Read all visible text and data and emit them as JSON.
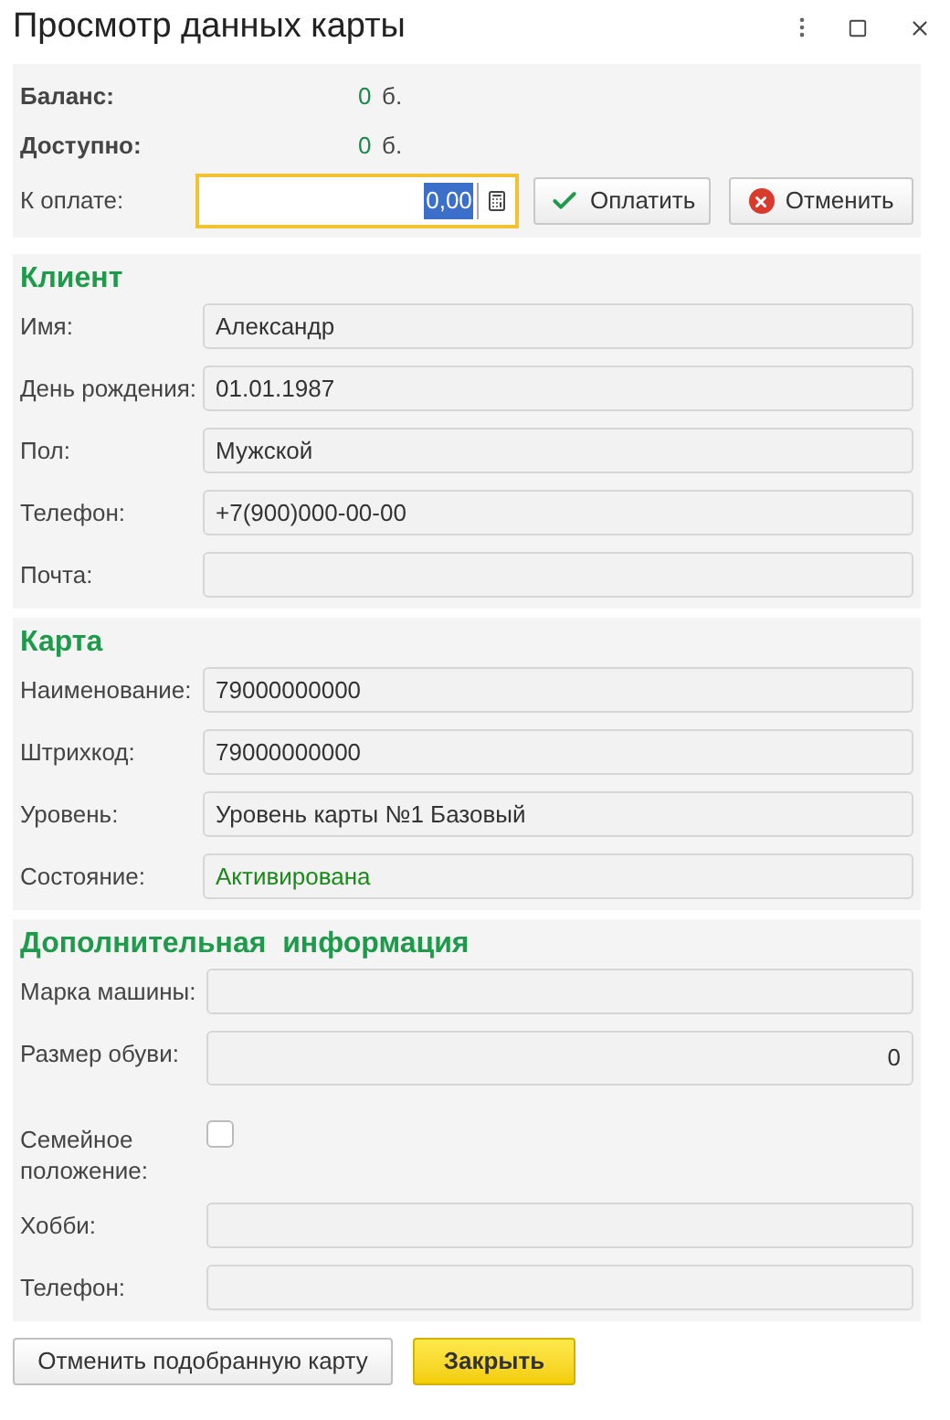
{
  "window": {
    "title": "Просмотр данных карты"
  },
  "summary": [
    {
      "label": "Баланс:",
      "value": "0",
      "unit": "б."
    },
    {
      "label": "Доступно:",
      "value": "0",
      "unit": "б."
    }
  ],
  "payment": {
    "label": "К оплате:",
    "value": "0,00",
    "focused": true,
    "buttons": [
      {
        "label": "Оплатить",
        "kind": "confirm"
      },
      {
        "label": "Отменить",
        "kind": "cancel"
      }
    ]
  },
  "sections": [
    {
      "title": "Клиент",
      "fields": [
        {
          "label": "Имя:",
          "value": "Александр",
          "kind": "text"
        },
        {
          "label": "День рождения:",
          "value": "01.01.1987",
          "kind": "text"
        },
        {
          "label": "Пол:",
          "value": "Мужской",
          "kind": "text"
        },
        {
          "label": "Телефон:",
          "value": "+7(900)000-00-00",
          "kind": "text"
        },
        {
          "label": "Почта:",
          "kind": "text"
        }
      ]
    },
    {
      "title": "Карта",
      "fields": [
        {
          "label": "Наименование:",
          "value": "79000000000",
          "kind": "text"
        },
        {
          "label": "Штрихкод:",
          "value": "79000000000",
          "kind": "text"
        },
        {
          "label": "Уровень:",
          "value": "Уровень карты №1 Базовый",
          "kind": "text"
        },
        {
          "label": "Состояние:",
          "value": "Активирована",
          "kind": "text",
          "color": "#1a8a1a"
        }
      ]
    },
    {
      "title": "Дополнительная  информация",
      "fields": [
        {
          "label": "Марка машины:",
          "kind": "text"
        },
        {
          "label": "Размер обуви:",
          "value": "0",
          "kind": "number"
        },
        {
          "label": "Семейное положение:",
          "kind": "checkbox",
          "checked": false
        },
        {
          "label": "Хобби:",
          "kind": "text"
        },
        {
          "label": "Телефон:",
          "kind": "text"
        }
      ]
    }
  ],
  "footer_buttons": [
    {
      "label": "Отменить подобранную карту",
      "kind": "default"
    },
    {
      "label": "Закрыть",
      "kind": "primary"
    }
  ]
}
